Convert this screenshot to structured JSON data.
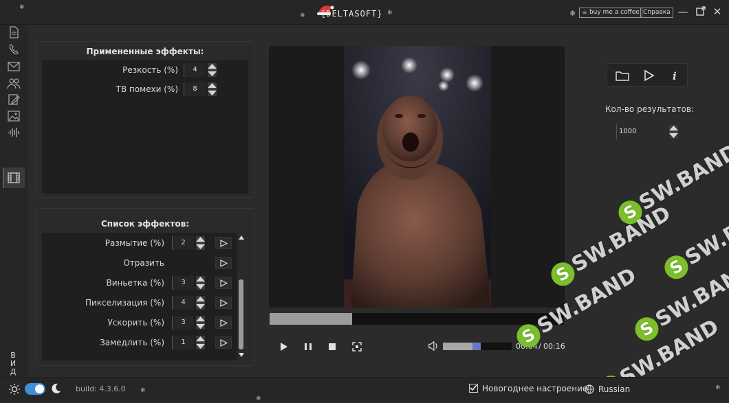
{
  "app": {
    "logo_text": "{DELTASOFT}",
    "donate_label": "buy me a coffee",
    "help_label": "Справка"
  },
  "sidebar": {
    "vertical_label": "ВИДЕО",
    "icons": [
      "document-icon",
      "phone-icon",
      "mail-icon",
      "users-icon",
      "edit-icon",
      "image-icon",
      "audio-wave-icon",
      "film-icon"
    ]
  },
  "applied": {
    "title": "Примененные эффекты:",
    "items": [
      {
        "label": "Резкость (%)",
        "value": "4"
      },
      {
        "label": "ТВ помехи (%)",
        "value": "8"
      }
    ]
  },
  "effects": {
    "title": "Список эффектов:",
    "items": [
      {
        "label": "Размытие (%)",
        "value": "2",
        "has_value": true
      },
      {
        "label": "Отразить",
        "value": "",
        "has_value": false
      },
      {
        "label": "Виньетка (%)",
        "value": "3",
        "has_value": true
      },
      {
        "label": "Пикселизация (%)",
        "value": "4",
        "has_value": true
      },
      {
        "label": "Ускорить (%)",
        "value": "3",
        "has_value": true
      },
      {
        "label": "Замедлить (%)",
        "value": "1",
        "has_value": true
      }
    ]
  },
  "player": {
    "progress_fraction": 0.28,
    "volume_fraction": 0.55,
    "current_time": "00:04",
    "separator": "/",
    "total_time": "00:16"
  },
  "results": {
    "label": "Кол-во результатов:",
    "value": "1000"
  },
  "footer": {
    "build": "build: 4.3.6.0",
    "newyear_label": "Новогоднее настроение",
    "newyear_checked": true,
    "language": "Russian",
    "theme_dark": true
  },
  "watermark": "SW.BAND",
  "colors": {
    "accent": "#3d8fd8",
    "watermark_green": "#7bbf2a",
    "logo_red": "#e04646"
  }
}
